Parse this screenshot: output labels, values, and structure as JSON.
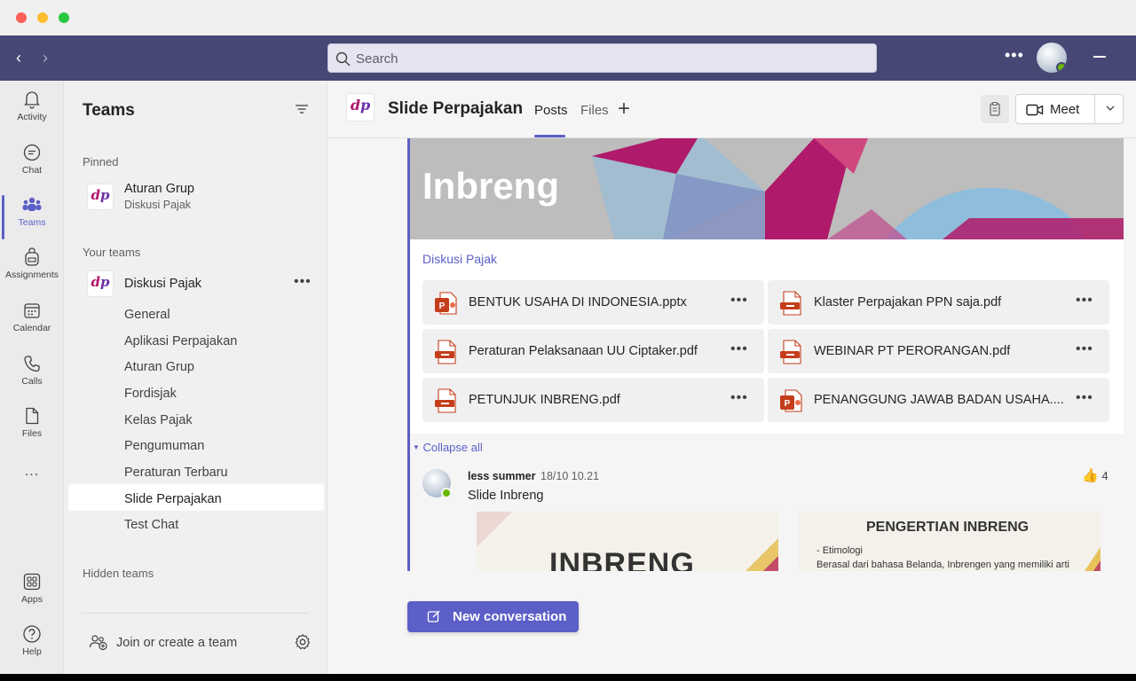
{
  "search": {
    "placeholder": "Search"
  },
  "rail": {
    "items": [
      {
        "label": "Activity",
        "icon": "bell-icon"
      },
      {
        "label": "Chat",
        "icon": "chat-icon"
      },
      {
        "label": "Teams",
        "icon": "teams-icon",
        "active": true
      },
      {
        "label": "Assignments",
        "icon": "backpack-icon"
      },
      {
        "label": "Calendar",
        "icon": "calendar-icon"
      },
      {
        "label": "Calls",
        "icon": "phone-icon"
      },
      {
        "label": "Files",
        "icon": "file-icon"
      }
    ],
    "more": "...",
    "apps_label": "Apps",
    "help_label": "Help"
  },
  "panel": {
    "title": "Teams",
    "pinned_label": "Pinned",
    "pinned_item": {
      "name": "Aturan Grup",
      "sub": "Diskusi Pajak"
    },
    "your_teams_label": "Your teams",
    "team_name": "Diskusi Pajak",
    "channels": [
      "General",
      "Aplikasi Perpajakan",
      "Aturan Grup",
      "Fordisjak",
      "Kelas Pajak",
      "Pengumuman",
      "Peraturan Terbaru",
      "Slide Perpajakan",
      "Test Chat"
    ],
    "active_channel": "Slide Perpajakan",
    "hidden_label": "Hidden teams",
    "join_label": "Join or create a team"
  },
  "header": {
    "title": "Slide Perpajakan",
    "tabs": [
      "Posts",
      "Files"
    ],
    "meet_label": "Meet"
  },
  "post": {
    "banner_title": "Inbreng",
    "source": "Diskusi Pajak",
    "files": [
      {
        "name": "BENTUK USAHA DI INDONESIA.pptx",
        "type": "pptx"
      },
      {
        "name": "Klaster Perpajakan PPN saja.pdf",
        "type": "pdf"
      },
      {
        "name": "Peraturan Pelaksanaan UU Ciptaker.pdf",
        "type": "pdf"
      },
      {
        "name": "WEBINAR PT PERORANGAN.pdf",
        "type": "pdf"
      },
      {
        "name": "PETUNJUK INBRENG.pdf",
        "type": "pdf"
      },
      {
        "name": "PENANGGUNG JAWAB BADAN USAHA....",
        "type": "pptx"
      }
    ],
    "collapse_label": "Collapse all"
  },
  "reply": {
    "author": "less summer",
    "time": "18/10 10.21",
    "text": "Slide Inbreng",
    "reaction_count": "4",
    "slide1_title": "INBRENG",
    "slide2_title": "PENGERTIAN INBRENG",
    "slide2_bullet": "-   Etimologi",
    "slide2_body": "Berasal dari bahasa Belanda, Inbrengen yang memiliki arti"
  },
  "compose": {
    "new_conversation_label": "New conversation"
  },
  "colors": {
    "brand": "#5b5fc7",
    "topbar": "#464775",
    "presence": "#6bb700",
    "pdf": "#c43e1c"
  }
}
